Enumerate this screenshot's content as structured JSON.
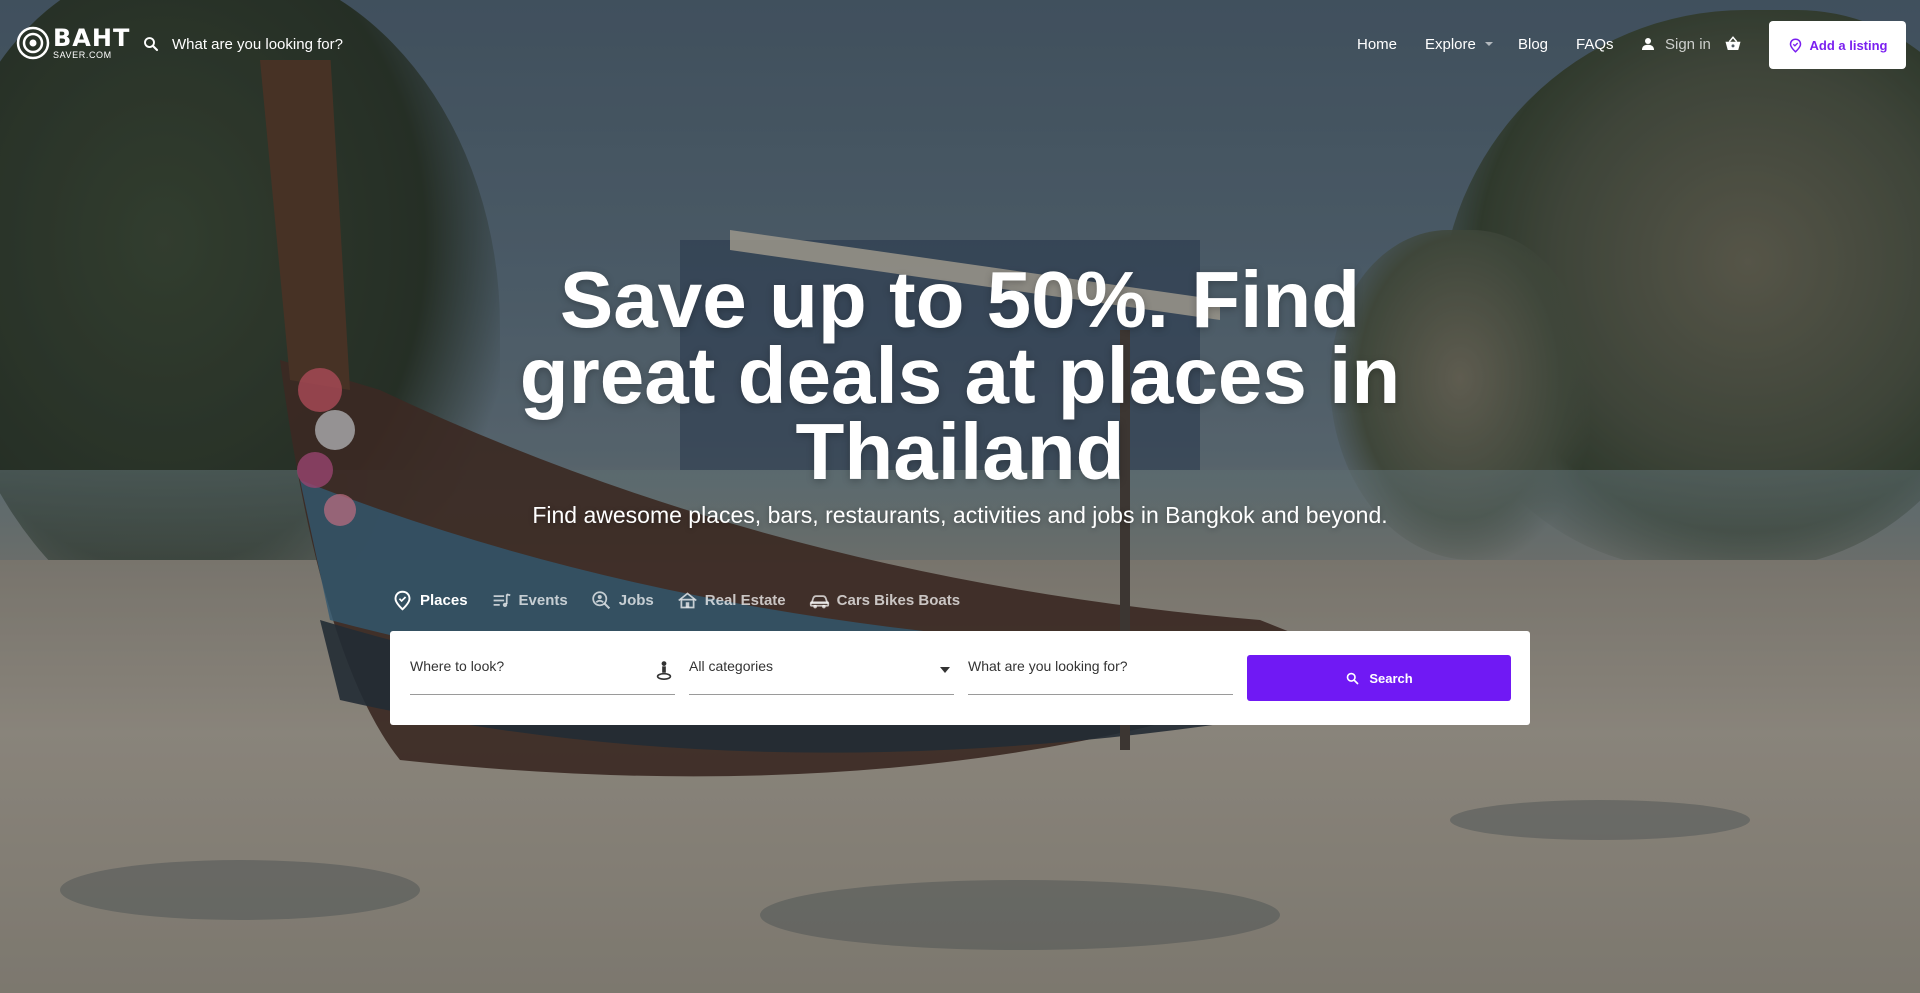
{
  "header": {
    "logo_text": "BAHT",
    "logo_subtext": "SAVER.COM",
    "search_placeholder": "What are you looking for?",
    "nav": {
      "home": "Home",
      "explore": "Explore",
      "blog": "Blog",
      "faqs": "FAQs",
      "sign_in": "Sign in",
      "add_listing": "Add a listing"
    }
  },
  "hero": {
    "title_line1": "Save up to 50%. Find",
    "title_line2": "great deals at places in",
    "title_line3": "Thailand",
    "subtitle": "Find awesome places, bars, restaurants, activities and jobs in Bangkok and beyond."
  },
  "tabs": [
    {
      "label": "Places",
      "icon": "map-pin-icon",
      "active": true
    },
    {
      "label": "Events",
      "icon": "playlist-icon",
      "active": false
    },
    {
      "label": "Jobs",
      "icon": "job-search-icon",
      "active": false
    },
    {
      "label": "Real Estate",
      "icon": "house-icon",
      "active": false
    },
    {
      "label": "Cars Bikes Boats",
      "icon": "car-icon",
      "active": false
    }
  ],
  "search": {
    "where_placeholder": "Where to look?",
    "category_value": "All categories",
    "what_placeholder": "What are you looking for?",
    "button_label": "Search"
  },
  "colors": {
    "accent": "#7019f4",
    "add_listing_text": "#7a1ff0"
  }
}
